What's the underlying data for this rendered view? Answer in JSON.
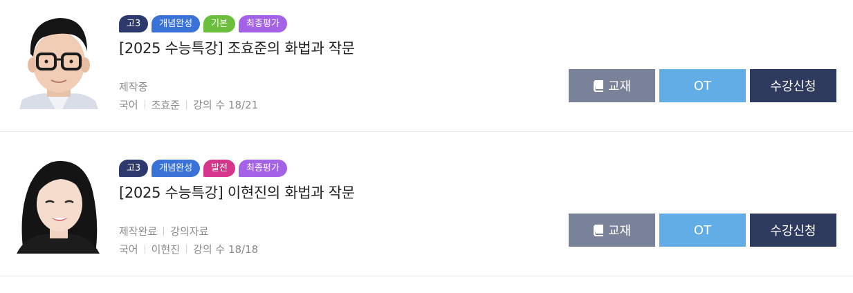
{
  "courses": [
    {
      "badges": [
        {
          "label": "고3",
          "color": "#2e3a6e"
        },
        {
          "label": "개념완성",
          "color": "#3a72d8"
        },
        {
          "label": "기본",
          "color": "#6cbf3c"
        },
        {
          "label": "최종평가",
          "color": "#a463e6"
        }
      ],
      "title": "[2025 수능특강] 조효준의 화법과 작문",
      "status": [
        "제작중"
      ],
      "meta": {
        "subject": "국어",
        "teacher": "조효준",
        "lectures": "강의 수 18/21"
      },
      "buttons": {
        "book": "교재",
        "ot": "OT",
        "enroll": "수강신청"
      },
      "avatar": "male-teacher-glasses"
    },
    {
      "badges": [
        {
          "label": "고3",
          "color": "#2e3a6e"
        },
        {
          "label": "개념완성",
          "color": "#3a72d8"
        },
        {
          "label": "발전",
          "color": "#d6358c"
        },
        {
          "label": "최종평가",
          "color": "#a463e6"
        }
      ],
      "title": "[2025 수능특강] 이현진의 화법과 작문",
      "status": [
        "제작완료",
        "강의자료"
      ],
      "meta": {
        "subject": "국어",
        "teacher": "이현진",
        "lectures": "강의 수 18/18"
      },
      "buttons": {
        "book": "교재",
        "ot": "OT",
        "enroll": "수강신청"
      },
      "avatar": "female-teacher"
    }
  ]
}
